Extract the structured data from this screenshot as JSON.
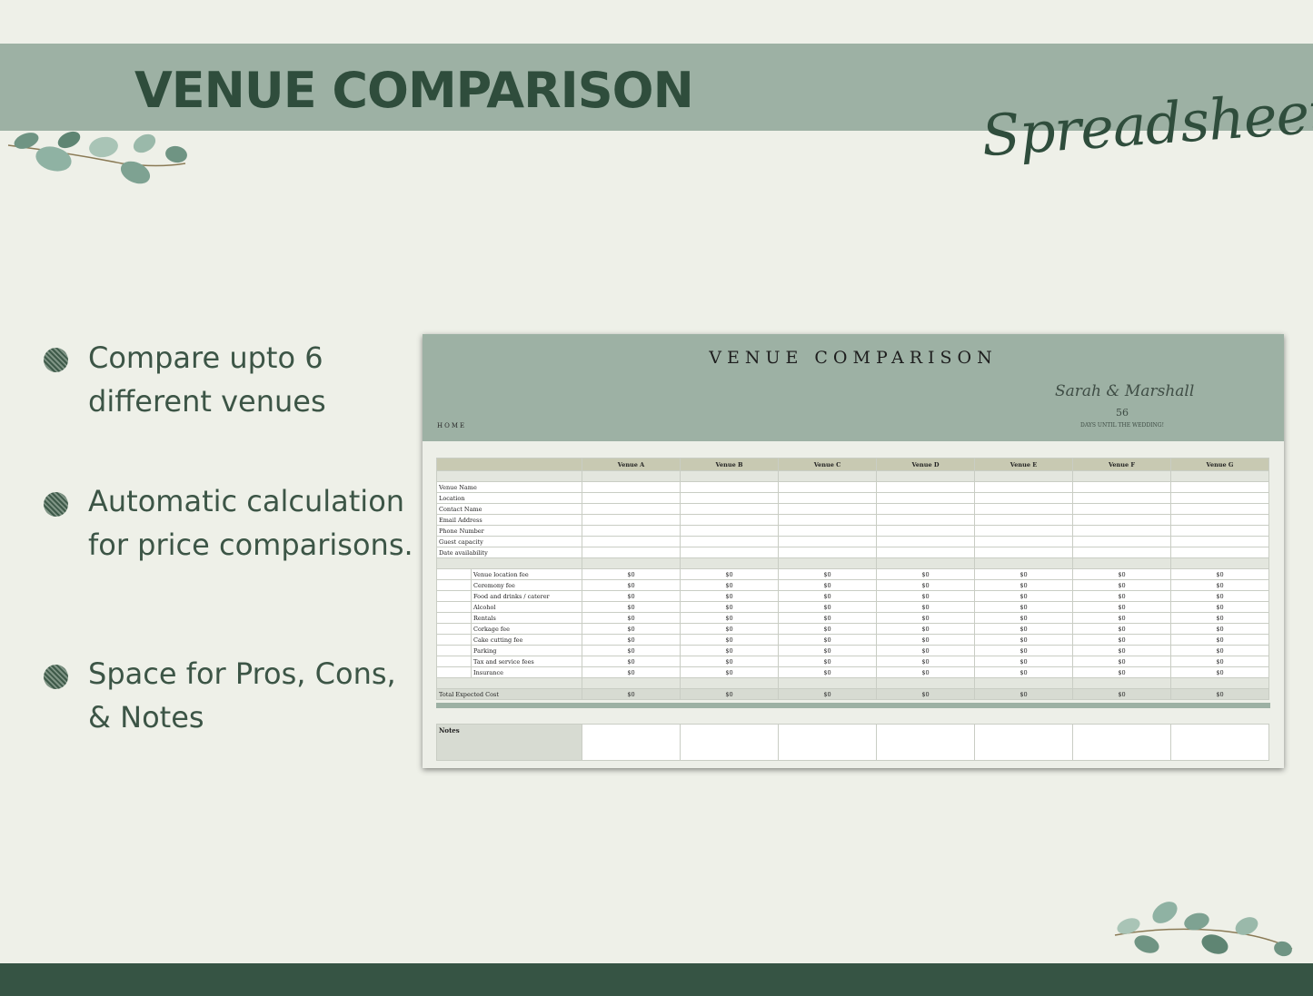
{
  "page": {
    "title": "VENUE COMPARISON",
    "subtitle": "Spreadsheet"
  },
  "features": [
    {
      "text": "Compare upto 6 different venues"
    },
    {
      "text": "Automatic calculation for price comparisons."
    },
    {
      "text": "Space for Pros, Cons, & Notes"
    }
  ],
  "sheet": {
    "title": "VENUE COMPARISON",
    "couple": "Sarah & Marshall",
    "days_count": "56",
    "days_label": "DAYS UNTIL THE WEDDING!",
    "home": "HOME",
    "venues": [
      "Venue A",
      "Venue B",
      "Venue C",
      "Venue D",
      "Venue E",
      "Venue F",
      "Venue G"
    ],
    "info_rows": [
      "Venue Name",
      "Location",
      "Contact Name",
      "Email Address",
      "Phone Number",
      "Guest capacity",
      "Date availability"
    ],
    "cost_rows": [
      "Venue location fee",
      "Ceremony fee",
      "Food and drinks / caterer",
      "Alcohol",
      "Rentals",
      "Corkage fee",
      "Cake cutting fee",
      "Parking",
      "Tax and service fees",
      "Insurance"
    ],
    "cell_value": "$0",
    "total_label": "Total Expected Cost",
    "notes_label": "Notes"
  },
  "colors": {
    "banner": "#9db1a4",
    "dark_green": "#2f4d3c",
    "footer": "#365444",
    "background": "#eef0e8"
  }
}
